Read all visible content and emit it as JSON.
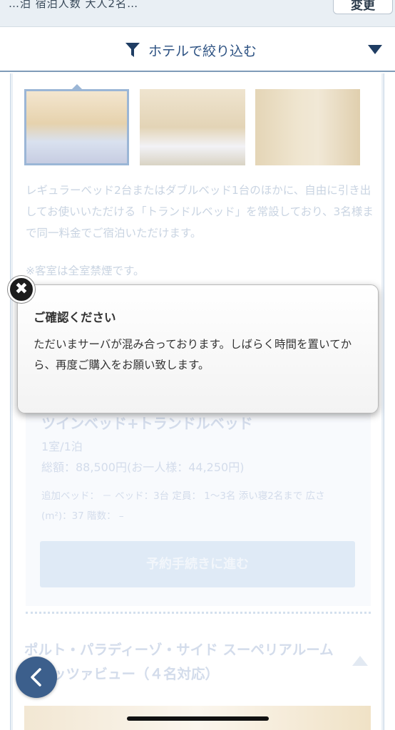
{
  "top_bar": {
    "partial_text": "…泊 宿泊人数 大人2名…",
    "change_button": "変更"
  },
  "filter_bar": {
    "label": "ホテルで絞り込む"
  },
  "room_section": {
    "description": "レギュラーベッド2台またはダブルベッド1台のほかに、自由に引き出してお使いいただける「トランドルベッド」を常設しており、3名様まで同一料金でご宿泊いただけます。",
    "note": "※客室は全室禁煙です。"
  },
  "plan": {
    "title": "ツインベッド+トランドルベッド",
    "unit": "1室/1泊",
    "total": "総額：88,500円(お一人様：44,250円)",
    "spec": "追加ベッド： － ベッド：3台 定員： 1～3名 添い寝2名まで 広さ(m²)：37 階数： –",
    "reserve_button": "予約手続きに進む"
  },
  "next_room": {
    "title": "ポルト・パラディーゾ・サイド スーペリアルーム ピアッツァビュー（４名対応）"
  },
  "dialog": {
    "title": "ご確認ください",
    "body": "ただいまサーバが混み合っております。しばらく時間を置いてから、再度ご購入をお願い致します。",
    "close_symbol": "✖"
  },
  "colors": {
    "brand_navy": "#2c5182",
    "back_button": "#3c5f8c"
  }
}
